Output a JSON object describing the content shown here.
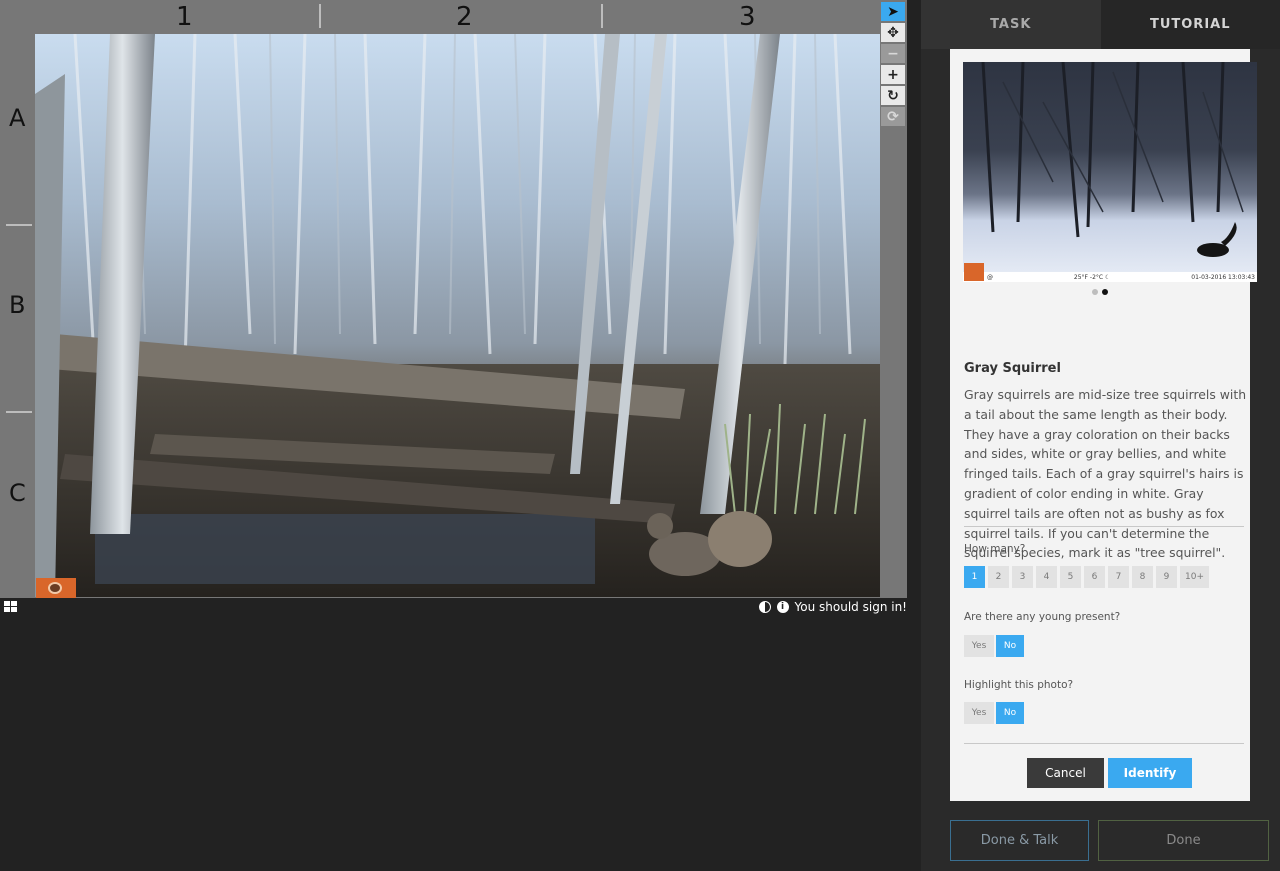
{
  "viewer": {
    "columns": [
      "1",
      "2",
      "3"
    ],
    "rows": [
      "A",
      "B",
      "C"
    ],
    "tools": [
      {
        "name": "select",
        "glyph": "➤",
        "active": true
      },
      {
        "name": "move",
        "glyph": "✥"
      },
      {
        "name": "zoom-out",
        "glyph": "−",
        "disabled": true
      },
      {
        "name": "zoom-in",
        "glyph": "+"
      },
      {
        "name": "rotate",
        "glyph": "↻"
      },
      {
        "name": "reset",
        "glyph": "⟳",
        "disabled": true
      }
    ],
    "sign_in_text": "You should sign in!"
  },
  "tabs": {
    "task": "TASK",
    "tutorial": "TUTORIAL"
  },
  "tutorial": {
    "thumb_info_left": "@",
    "thumb_info_mid": "25°F -2°C ☾",
    "thumb_info_right": "01-03-2016 13:03:43",
    "species_name": "Gray Squirrel",
    "species_description": "Gray squirrels are mid-size tree squirrels with a tail about the same length as their body. They have a gray coloration on their backs and sides, white or gray bellies, and white fringed tails. Each of a gray squirrel's hairs is gradient of color ending in white. Gray squirrel tails are often not as bushy as fox squirrel tails. If you can't determine the squirrel species, mark it as \"tree squirrel\".",
    "how_many_label": "How many?",
    "count_options": [
      "1",
      "2",
      "3",
      "4",
      "5",
      "6",
      "7",
      "8",
      "9",
      "10+"
    ],
    "count_selected": "1",
    "young_label": "Are there any young present?",
    "young_yes": "Yes",
    "young_no": "No",
    "highlight_label": "Highlight this photo?",
    "highlight_yes": "Yes",
    "highlight_no": "No",
    "cancel_label": "Cancel",
    "identify_label": "Identify"
  },
  "footer": {
    "done_talk_label": "Done & Talk",
    "done_label": "Done"
  },
  "colors": {
    "accent": "#3aa9f0",
    "panel_bg": "#2a2a2a",
    "card_bg": "#f3f3f3"
  }
}
